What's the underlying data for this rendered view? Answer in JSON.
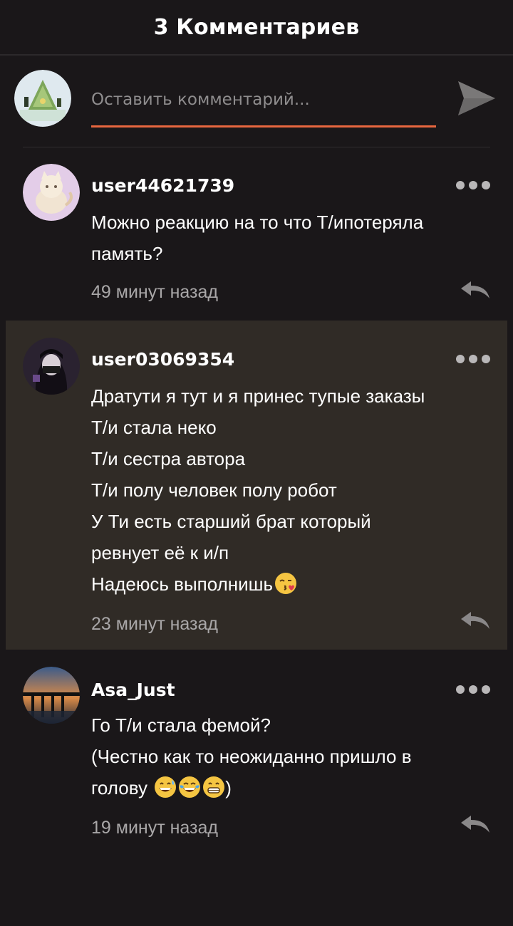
{
  "header": {
    "title": "3 Комментариев"
  },
  "compose": {
    "placeholder": "Оставить комментарий...",
    "accent_color": "#e8673f",
    "avatar_icon": "forest-scene-avatar",
    "send_icon": "send-icon"
  },
  "comments": [
    {
      "username": "user44621739",
      "avatar_icon": "cat-drawing-avatar",
      "lines": [
        "Можно реакцию на то что Т/ипотеряла",
        "память?"
      ],
      "time": "49 минут назад",
      "highlighted": false
    },
    {
      "username": "user03069354",
      "avatar_icon": "dark-anime-character-avatar",
      "lines": [
        "Дратути я тут и я принес тупые заказы",
        "Т/и стала неко",
        "Т/и сестра автора",
        "Т/и полу человек полу робот",
        "У Ти есть старший брат который",
        "ревнует её к и/п",
        "Надеюсь выполнишь"
      ],
      "trailing_emoji": "kissing-face-emoji",
      "time": "23 минут назад",
      "highlighted": true,
      "highlight_color": "#302b26"
    },
    {
      "username": "Asa_Just",
      "avatar_icon": "bridge-sunset-avatar",
      "lines": [
        "Го Т/и стала фемой?",
        "(Честно как то неожиданно пришло в",
        "голову"
      ],
      "trailing_emojis": [
        "grinning-sweat-emoji",
        "tears-of-joy-emoji",
        "beaming-face-emoji"
      ],
      "closing": ")",
      "time": "19 минут назад",
      "highlighted": false
    }
  ]
}
